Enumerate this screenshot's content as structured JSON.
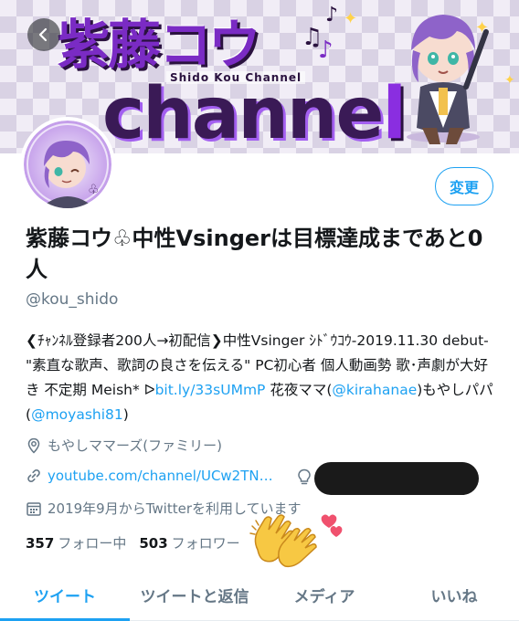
{
  "banner": {
    "title": "紫藤コウ",
    "subtitle": "Shido Kou Channel",
    "channel_pre": "channe",
    "channel_accent": "l"
  },
  "profile": {
    "edit_label": "変更",
    "display_name": "紫藤コウ♧中性Vsingerは目標達成まであと0人",
    "handle": "@kou_shido",
    "bio_parts": {
      "p1": "❮ﾁｬﾝﾈﾙ登録者200人→初配信❯中性Vsinger ｼﾄﾞｳｺｳ-2019.11.30 debut- \"素直な歌声、歌詞の良さを伝える\" PC初心者 個人動画勢 歌･声劇が大好き 不定期 Meish* ᐅ",
      "link1": "bit.ly/33sUMmP",
      "p2": " 花夜ママ(",
      "link2": "@kirahanae",
      "p3": ")もやしパパ(",
      "link3": "@moyashi81",
      "p4": ")"
    },
    "location": "もやしママーズ(ファミリー)",
    "website": "youtube.com/channel/UCw2TN…",
    "joined": "2019年9月からTwitterを利用しています",
    "following_count": "357",
    "following_label": "フォロー中",
    "followers_count": "503",
    "followers_label": "フォロワー"
  },
  "tabs": [
    {
      "label": "ツイート",
      "active": true
    },
    {
      "label": "ツイートと返信",
      "active": false
    },
    {
      "label": "メディア",
      "active": false
    },
    {
      "label": "いいね",
      "active": false
    }
  ],
  "colors": {
    "accent": "#1da1f2",
    "secondary_text": "#657786",
    "banner_purple": "#7a2bc4"
  },
  "icons": [
    "back-arrow-icon",
    "location-pin-icon",
    "link-icon",
    "lightbulb-icon",
    "calendar-icon",
    "clapping-hands-icon",
    "hearts-icon"
  ]
}
